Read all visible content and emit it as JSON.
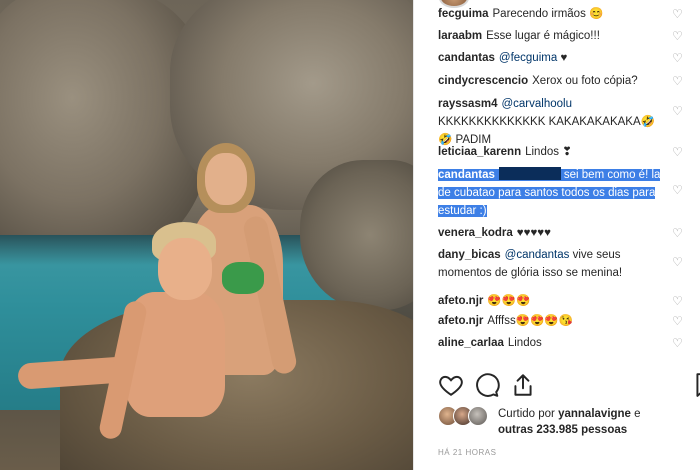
{
  "comments": [
    {
      "user": "fecguima",
      "text": "Parecendo irmãos 😊",
      "liked": false
    },
    {
      "user": "laraabm",
      "text": "Esse lugar é mágico!!!",
      "liked": false
    },
    {
      "user": "candantas",
      "mention": "@fecguima",
      "text": "♥",
      "liked": false
    },
    {
      "user": "cindycrescencio",
      "text": "Xerox ou foto cópia?",
      "liked": false
    },
    {
      "user": "rayssasm4",
      "mention": "@carvalhoolu",
      "text": "KKKKKKKKKKKKKK KAKAKAKAKAKA🤣🤣 PADIM",
      "liked": false
    },
    {
      "user": "leticiaa_karenn",
      "text": "Lindos ❣",
      "liked": false
    },
    {
      "user": "candantas",
      "text": "sei bem como é! la de cubatao para santos todos os dias para estudar :)",
      "liked": false,
      "selected": true
    },
    {
      "user": "venera_kodra",
      "text": "♥♥♥♥♥",
      "liked": false
    },
    {
      "user": "dany_bicas",
      "mention": "@candantas",
      "text": "vive seus momentos de glória isso se menina!",
      "liked": false
    },
    {
      "user": "afeto.njr",
      "text": "😍😍😍",
      "liked": false
    },
    {
      "user": "afeto.njr",
      "text": "Afffss😍😍😍😘",
      "liked": false
    },
    {
      "user": "aline_carlaa",
      "text": "Lindos",
      "liked": false
    }
  ],
  "actions": {
    "like_icon": "heart-outline-icon",
    "comment_icon": "comment-bubble-icon",
    "share_icon": "share-upload-icon",
    "save_icon": "bookmark-icon"
  },
  "likes": {
    "liked_by_prefix": "Curtido por",
    "liked_by_user": "yannalavigne",
    "connector": "e",
    "others": "outras 233.985 pessoas"
  },
  "timestamp": "HÁ 21 HORAS"
}
